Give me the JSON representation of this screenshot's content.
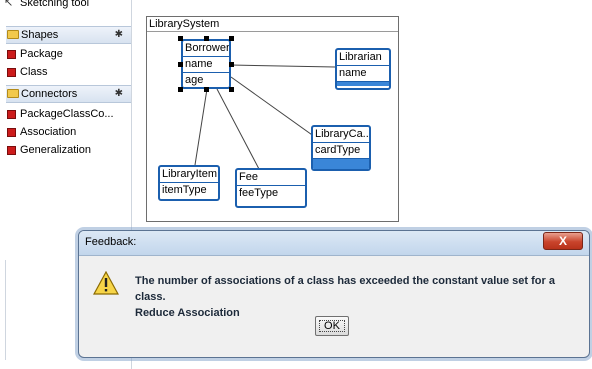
{
  "palette": {
    "sketching_tool": "Sketching tool",
    "shapes_header": "Shapes",
    "shapes": [
      "Package",
      "Class"
    ],
    "connectors_header": "Connectors",
    "connectors": [
      "PackageClassCo...",
      "Association",
      "Generalization"
    ],
    "pin_glyph": "✱"
  },
  "diagram": {
    "title": "LibrarySystem",
    "classes": {
      "borrower": {
        "name": "Borrower",
        "attrs": [
          "name",
          "age"
        ]
      },
      "librarian": {
        "name": "Librarian",
        "attrs": [
          "name"
        ]
      },
      "libraryitem": {
        "name": "LibraryItem",
        "attrs": [
          "itemType"
        ]
      },
      "fee": {
        "name": "Fee",
        "attrs": [
          "feeType"
        ]
      },
      "librarycard": {
        "name": "LibraryCa...",
        "attrs": [
          "cardType"
        ]
      }
    },
    "colors": {
      "class_border": "#1b5fae",
      "class_bar": "#3a86d8"
    }
  },
  "dialog": {
    "title": "Feedback:",
    "message_line1": "The number of associations of a class has exceeded the constant value set for a class.",
    "message_line2": "Reduce Association",
    "ok_label": "OK",
    "close_glyph": "X",
    "icon": "warning-icon"
  }
}
